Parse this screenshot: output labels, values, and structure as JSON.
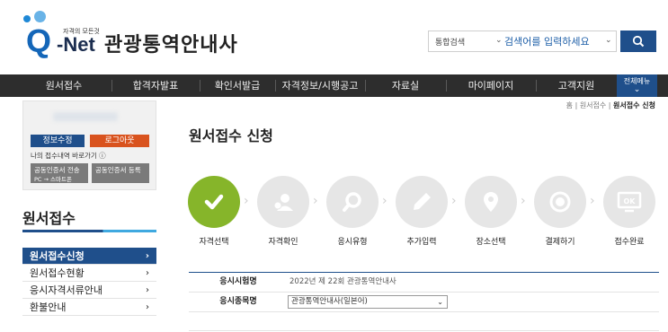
{
  "brand": {
    "logo_tagline": "자격의 모든것",
    "logo_q": "Q",
    "logo_net": "-Net",
    "site_title": "관광통역안내사"
  },
  "search": {
    "scope_label": "통합검색",
    "placeholder": "검색어를 입력하세요",
    "button_icon": "search-icon"
  },
  "nav": {
    "items": [
      "원서접수",
      "합격자발표",
      "확인서발급",
      "자격정보/시행공고",
      "자료실",
      "마이페이지",
      "고객지원"
    ],
    "all_menu_label": "전체메뉴"
  },
  "breadcrumb": {
    "home": "홈",
    "parent": "원서접수",
    "current": "원서접수 신청"
  },
  "user_box": {
    "profile_button": "정보수정",
    "logout_button": "로그아웃",
    "my_apps_link": "나의 접수내역 바로가기",
    "cert_transfer_button": "공동인증서 전송",
    "cert_transfer_sub": "PC → 스마트폰",
    "cert_register_button": "공동인증서 등록"
  },
  "sidebar": {
    "title": "원서접수",
    "items": [
      {
        "label": "원서접수신청",
        "active": true
      },
      {
        "label": "원서접수현황",
        "active": false
      },
      {
        "label": "응시자격서류안내",
        "active": false
      },
      {
        "label": "환불안내",
        "active": false
      }
    ]
  },
  "main": {
    "page_title": "원서접수 신청",
    "steps": [
      {
        "label": "자격선택",
        "icon": "check-icon",
        "done": true
      },
      {
        "label": "자격확인",
        "icon": "user-check-icon",
        "done": false
      },
      {
        "label": "응시유형",
        "icon": "magnifier-icon",
        "done": false
      },
      {
        "label": "추가입력",
        "icon": "pencil-icon",
        "done": false
      },
      {
        "label": "장소선택",
        "icon": "location-pin-icon",
        "done": false
      },
      {
        "label": "결제하기",
        "icon": "coin-icon",
        "done": false
      },
      {
        "label": "접수완료",
        "icon": "ok-monitor-icon",
        "done": false
      }
    ],
    "exam_session_label": "응시시험명",
    "exam_session_value": "2022년 제 22회 관광통역안내사",
    "exam_type_label": "응시종목명",
    "exam_type_value": "관광통역안내사(일본어)"
  },
  "colors": {
    "primary": "#1f4f8b",
    "accent_orange": "#d9531e",
    "done_green": "#86b52a",
    "nav_bg": "#2d2d2d"
  }
}
